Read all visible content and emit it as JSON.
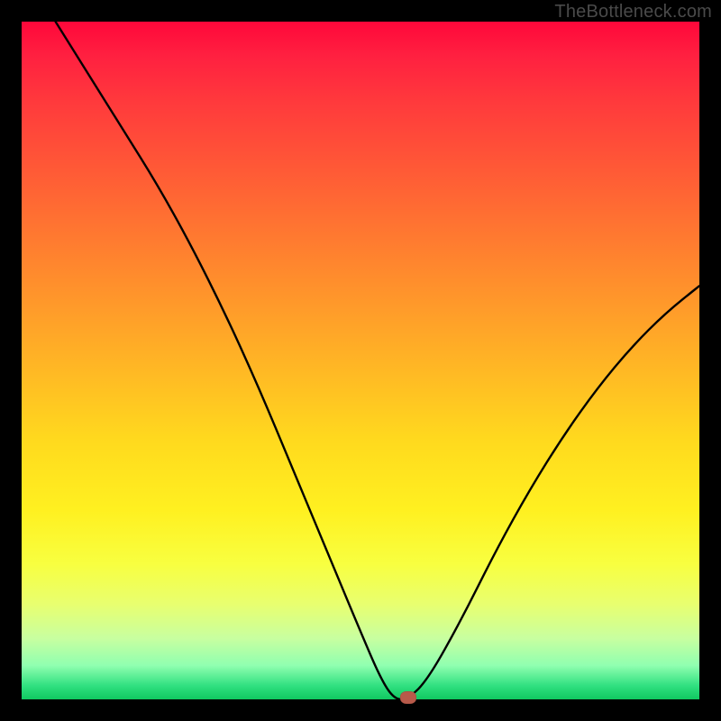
{
  "watermark": "TheBottleneck.com",
  "chart_data": {
    "type": "line",
    "title": "",
    "xlabel": "",
    "ylabel": "",
    "xlim": [
      0,
      100
    ],
    "ylim": [
      0,
      100
    ],
    "grid": false,
    "legend": false,
    "background_gradient": {
      "orientation": "vertical",
      "stops": [
        {
          "pos": 0,
          "color": "#ff073a"
        },
        {
          "pos": 50,
          "color": "#ffcc20"
        },
        {
          "pos": 85,
          "color": "#f2ff60"
        },
        {
          "pos": 100,
          "color": "#10c860"
        }
      ]
    },
    "series": [
      {
        "name": "bottleneck-curve",
        "x": [
          5,
          10,
          15,
          20,
          25,
          30,
          35,
          40,
          45,
          50,
          53,
          55,
          57,
          60,
          65,
          70,
          75,
          80,
          85,
          90,
          95,
          100
        ],
        "y": [
          100,
          92,
          84,
          76,
          67,
          57,
          46,
          34,
          22,
          10,
          3,
          0,
          0,
          3,
          12,
          22,
          31,
          39,
          46,
          52,
          57,
          61
        ]
      }
    ],
    "marker": {
      "x": 57,
      "y": 0,
      "color": "#b85a4a"
    }
  }
}
